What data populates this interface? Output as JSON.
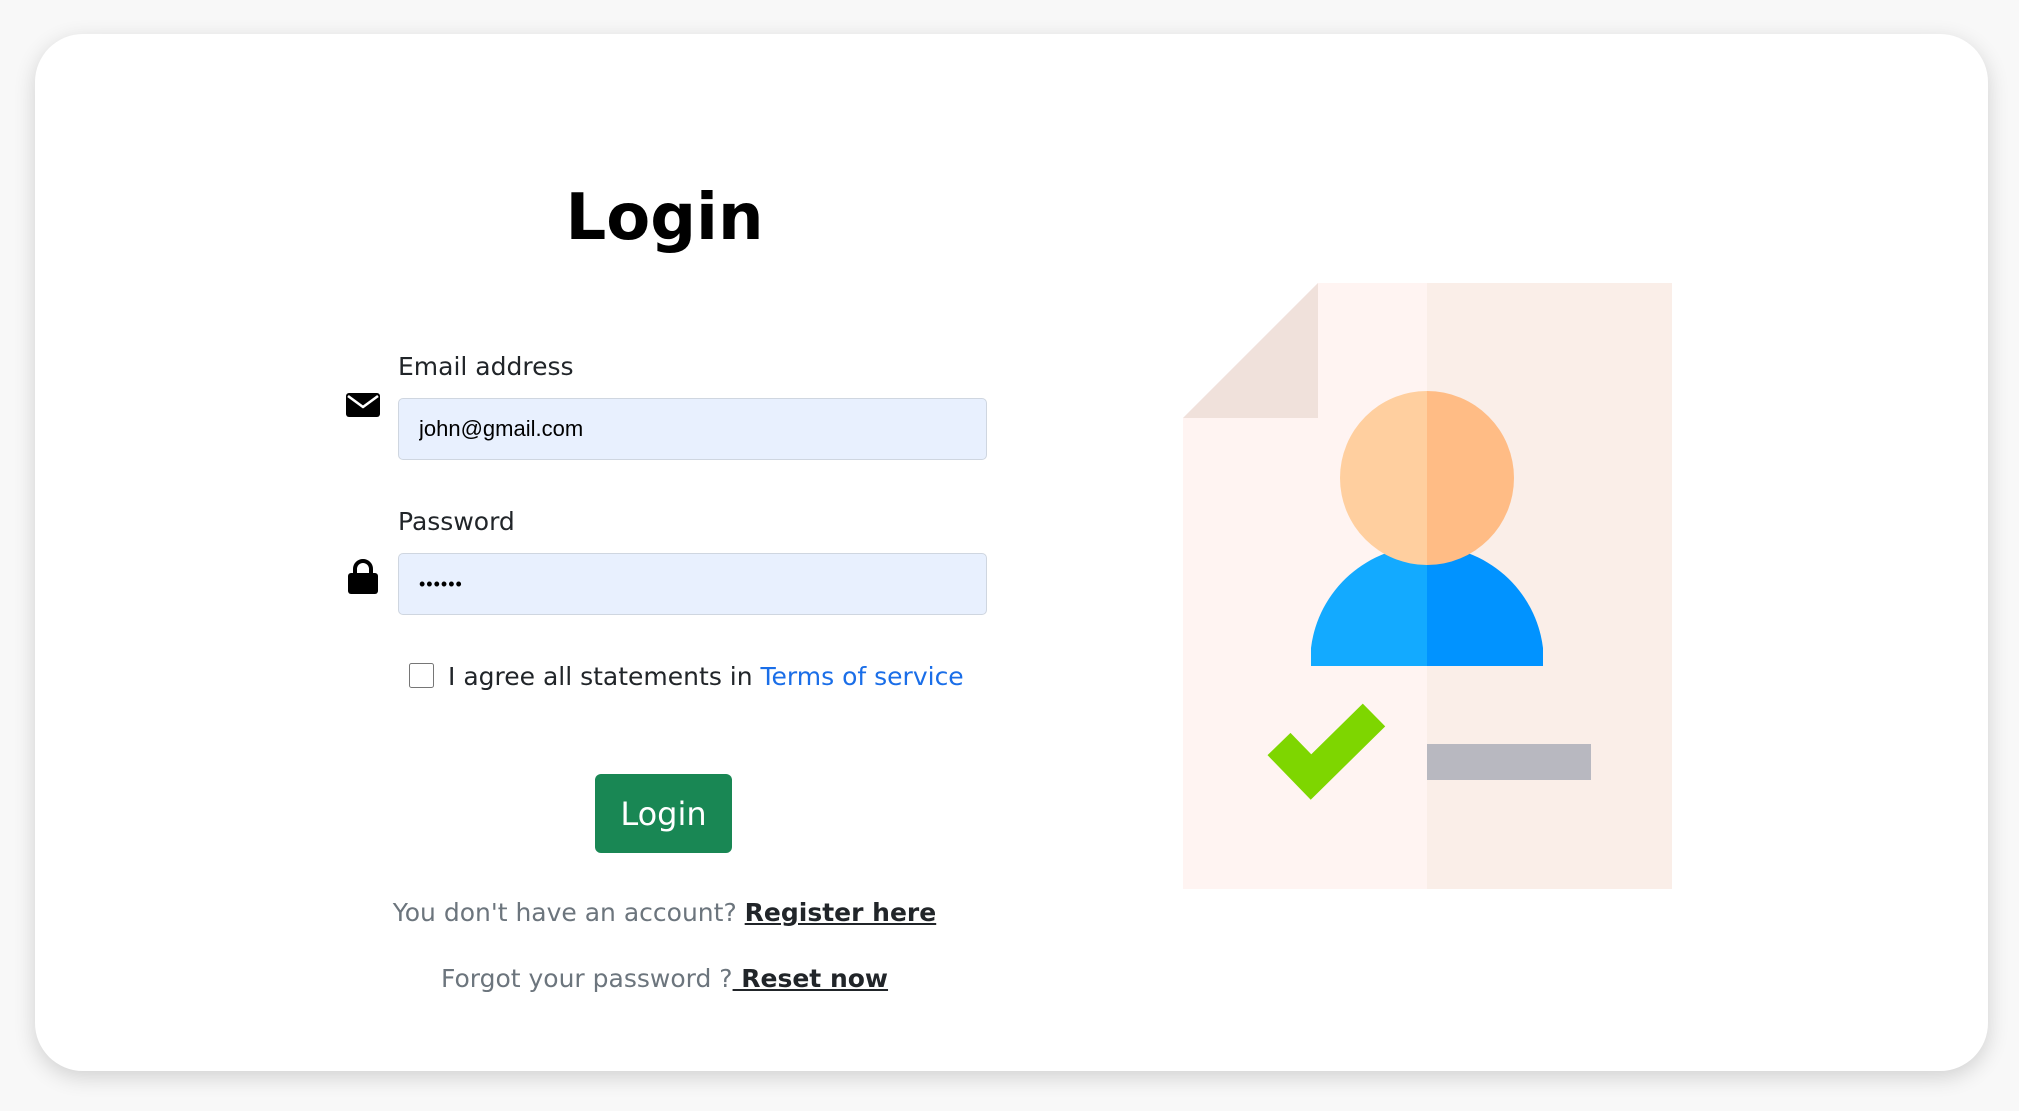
{
  "form": {
    "title": "Login",
    "email": {
      "label": "Email address",
      "value": "john@gmail.com",
      "icon": "envelope-icon"
    },
    "password": {
      "label": "Password",
      "value": "••••••",
      "icon": "lock-icon"
    },
    "terms": {
      "text": "I agree all statements in ",
      "link": "Terms of service",
      "checked": false
    },
    "submit_label": "Login",
    "register": {
      "prompt": "You don't have an account? ",
      "link": "Register here"
    },
    "reset": {
      "prompt": "Forgot your password ?",
      "link": " Reset now"
    }
  },
  "illustration": {
    "icon": "user-document-approved-icon"
  },
  "colors": {
    "primary_button": "#198754",
    "link": "#1a6ee8",
    "input_background": "#e8f0fe",
    "check_green": "#7ed600",
    "avatar_blue": "#1aa9ff",
    "avatar_skin": "#ffcf9f"
  }
}
